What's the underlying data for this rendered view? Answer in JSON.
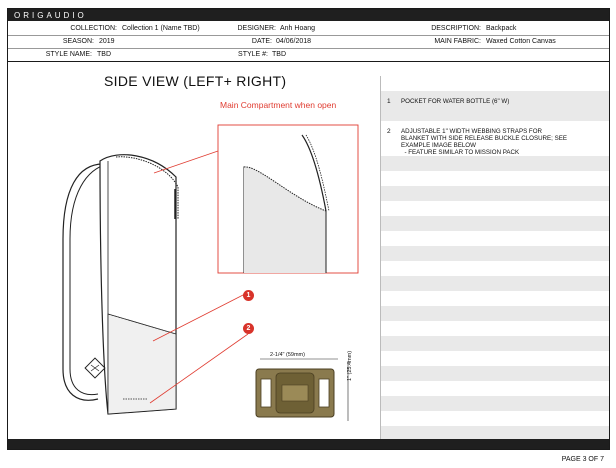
{
  "brand": "ORIGAUDIO",
  "header": {
    "collection_label": "COLLECTION:",
    "collection_value": "Collection 1 (Name TBD)",
    "designer_label": "DESIGNER:",
    "designer_value": "Anh Hoang",
    "description_label": "DESCRIPTION:",
    "description_value": "Backpack",
    "season_label": "SEASON:",
    "season_value": "2019",
    "date_label": "DATE:",
    "date_value": "04/06/2018",
    "fabric_label": "MAIN FABRIC:",
    "fabric_value": "Waxed Cotton Canvas",
    "style_name_label": "STYLE NAME:",
    "style_name_value": "TBD",
    "style_no_label": "STYLE #:",
    "style_no_value": "TBD"
  },
  "view_title": "SIDE VIEW (LEFT+ RIGHT)",
  "callout": "Main Compartment when open",
  "markers": [
    "1",
    "2"
  ],
  "buckle": {
    "width_label": "2-1/4\" (59mm)",
    "height_label": "1\" (25.4mm)"
  },
  "notes": [
    {
      "num": "1",
      "lines": [
        "POCKET FOR WATER BOTTLE (6\" W)"
      ]
    },
    {
      "num": "2",
      "lines": [
        "ADJUSTABLE 1\" WIDTH WEBBING STRAPS FOR",
        "BLANKET WITH SIDE RELEASE BUCKLE CLOSURE; SEE",
        "EXAMPLE IMAGE BELOW",
        "  - FEATURE SIMILAR TO MISSION PACK"
      ]
    }
  ],
  "page_number": "PAGE 3 OF 7",
  "colors": {
    "accent_red": "#d8332a",
    "bar": "#1f1f1f"
  }
}
